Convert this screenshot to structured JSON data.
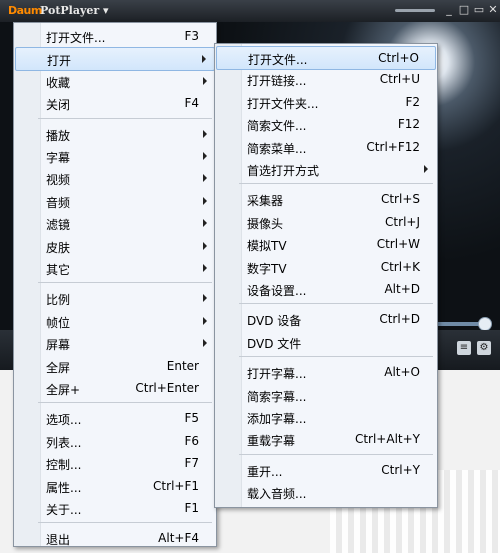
{
  "app": {
    "logo": "Daum",
    "title": "PotPlayer ▾"
  },
  "window_controls": [
    "▭",
    "_",
    "□",
    "✕"
  ],
  "main_menu": [
    {
      "label": "打开文件...",
      "shortcut": "F3",
      "submenu": false
    },
    {
      "label": "打开",
      "shortcut": "",
      "submenu": true,
      "highlighted": true
    },
    {
      "label": "收藏",
      "shortcut": "",
      "submenu": true
    },
    {
      "label": "关闭",
      "shortcut": "F4",
      "submenu": false
    },
    {
      "label": "播放",
      "shortcut": "",
      "submenu": true,
      "sep_before": true
    },
    {
      "label": "字幕",
      "shortcut": "",
      "submenu": true
    },
    {
      "label": "视频",
      "shortcut": "",
      "submenu": true
    },
    {
      "label": "音频",
      "shortcut": "",
      "submenu": true
    },
    {
      "label": "滤镜",
      "shortcut": "",
      "submenu": true
    },
    {
      "label": "皮肤",
      "shortcut": "",
      "submenu": true
    },
    {
      "label": "其它",
      "shortcut": "",
      "submenu": true
    },
    {
      "label": "比例",
      "shortcut": "",
      "submenu": true,
      "sep_before": true
    },
    {
      "label": "帧位",
      "shortcut": "",
      "submenu": true
    },
    {
      "label": "屏幕",
      "shortcut": "",
      "submenu": true
    },
    {
      "label": "全屏",
      "shortcut": "Enter",
      "submenu": false
    },
    {
      "label": "全屏+",
      "shortcut": "Ctrl+Enter",
      "submenu": false
    },
    {
      "label": "选项...",
      "shortcut": "F5",
      "submenu": false,
      "sep_before": true
    },
    {
      "label": "列表...",
      "shortcut": "F6",
      "submenu": false
    },
    {
      "label": "控制...",
      "shortcut": "F7",
      "submenu": false
    },
    {
      "label": "属性...",
      "shortcut": "Ctrl+F1",
      "submenu": false
    },
    {
      "label": "关于...",
      "shortcut": "F1",
      "submenu": false
    },
    {
      "label": "退出",
      "shortcut": "Alt+F4",
      "submenu": false,
      "sep_before": true
    }
  ],
  "open_submenu": [
    {
      "label": "打开文件...",
      "shortcut": "Ctrl+O",
      "highlighted": true
    },
    {
      "label": "打开链接...",
      "shortcut": "Ctrl+U"
    },
    {
      "label": "打开文件夹...",
      "shortcut": "F2"
    },
    {
      "label": "简索文件...",
      "shortcut": "F12"
    },
    {
      "label": "简索菜单...",
      "shortcut": "Ctrl+F12"
    },
    {
      "label": "首选打开方式",
      "shortcut": "",
      "submenu": true
    },
    {
      "label": "采集器",
      "shortcut": "Ctrl+S",
      "sep_before": true
    },
    {
      "label": "摄像头",
      "shortcut": "Ctrl+J"
    },
    {
      "label": "模拟TV",
      "shortcut": "Ctrl+W"
    },
    {
      "label": "数字TV",
      "shortcut": "Ctrl+K"
    },
    {
      "label": "设备设置...",
      "shortcut": "Alt+D"
    },
    {
      "label": "DVD 设备",
      "shortcut": "Ctrl+D",
      "sep_before": true
    },
    {
      "label": "DVD 文件",
      "shortcut": ""
    },
    {
      "label": "打开字幕...",
      "shortcut": "Alt+O",
      "sep_before": true
    },
    {
      "label": "简索字幕...",
      "shortcut": ""
    },
    {
      "label": "添加字幕...",
      "shortcut": ""
    },
    {
      "label": "重载字幕",
      "shortcut": "Ctrl+Alt+Y"
    },
    {
      "label": "重开...",
      "shortcut": "Ctrl+Y",
      "sep_before": true
    },
    {
      "label": "载入音频...",
      "shortcut": ""
    }
  ],
  "colors": {
    "highlight": "#d2e6fb",
    "menu_bg": "#f3f6fb",
    "player_bg": "#0d1115"
  }
}
